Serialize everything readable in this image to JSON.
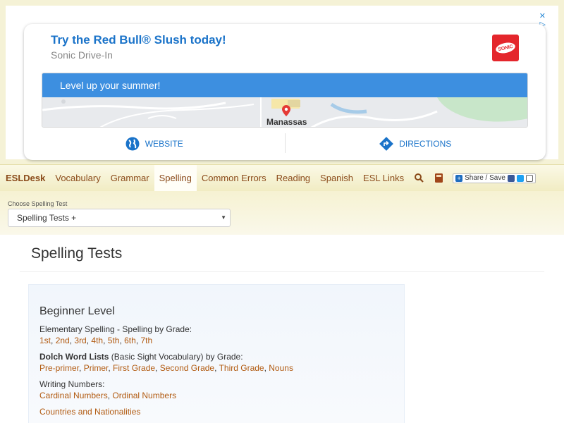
{
  "ad": {
    "badges": [
      "✕",
      "▷"
    ],
    "headline": "Try the Red Bull® Slush today!",
    "advertiser": "Sonic Drive-In",
    "logo_text": "SONIC",
    "banner": "Level up your summer!",
    "map_label": "Manassas",
    "website_label": "WEBSITE",
    "directions_label": "DIRECTIONS",
    "colors": {
      "accent": "#3d8fe0",
      "link": "#1a73c9",
      "logo": "#e4262c"
    }
  },
  "nav": {
    "brand": "ESLDesk",
    "items": [
      "Vocabulary",
      "Grammar",
      "Spelling",
      "Common Errors",
      "Reading",
      "Spanish",
      "ESL Links"
    ],
    "active": "Spelling",
    "icons": [
      "search-icon",
      "book-icon"
    ],
    "share_label": "Share / Save"
  },
  "selector": {
    "label": "Choose Spelling Test",
    "value": "Spelling Tests +"
  },
  "page": {
    "title": "Spelling Tests"
  },
  "beginner": {
    "title": "Beginner Level",
    "elementary_intro": "Elementary Spelling - Spelling by Grade:",
    "grades": [
      "1st",
      "2nd",
      "3rd",
      "4th",
      "5th",
      "6th",
      "7th"
    ],
    "dolch_title": "Dolch Word Lists",
    "dolch_rest": " (Basic Sight Vocabulary) by Grade:",
    "dolch_links": [
      "Pre-primer",
      "Primer",
      "First Grade",
      "Second Grade",
      "Third Grade",
      "Nouns"
    ],
    "numbers_intro": "Writing Numbers:",
    "numbers_links": [
      "Cardinal Numbers",
      "Ordinal Numbers"
    ],
    "countries": "Countries and Nationalities"
  }
}
